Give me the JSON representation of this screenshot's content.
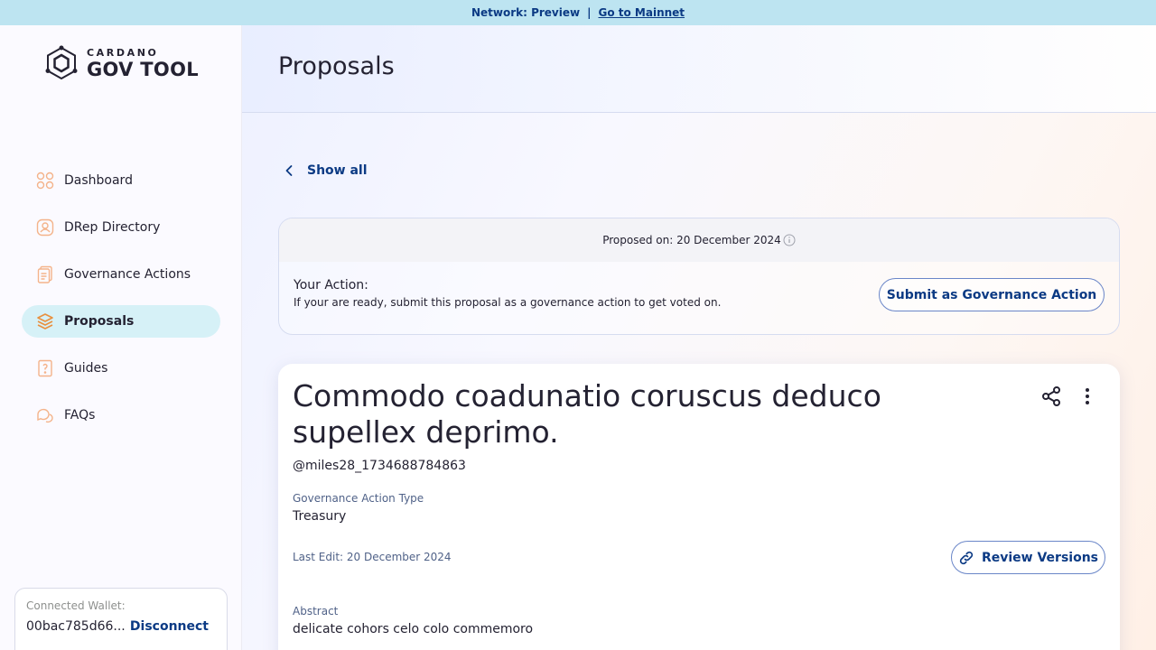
{
  "banner": {
    "network": "Network: Preview",
    "separator": "|",
    "link": "Go to Mainnet"
  },
  "logo": {
    "top": "CARDANO",
    "bottom": "GOV TOOL"
  },
  "nav": {
    "items": [
      {
        "label": "Dashboard",
        "icon": "dashboard-icon"
      },
      {
        "label": "DRep Directory",
        "icon": "drep-directory-icon"
      },
      {
        "label": "Governance Actions",
        "icon": "governance-actions-icon"
      },
      {
        "label": "Proposals",
        "icon": "proposals-icon",
        "active": true
      },
      {
        "label": "Guides",
        "icon": "guides-icon"
      },
      {
        "label": "FAQs",
        "icon": "faqs-icon"
      }
    ]
  },
  "wallet": {
    "label": "Connected Wallet:",
    "address": "00bac785d66...",
    "disconnect": "Disconnect"
  },
  "header": {
    "title": "Proposals"
  },
  "back": {
    "label": "Show all"
  },
  "action_card": {
    "proposed_on": "Proposed on: 20 December 2024",
    "title": "Your Action:",
    "subtitle": "If your are ready, submit this proposal as a governance action to get voted on.",
    "submit_label": "Submit as Governance Action"
  },
  "proposal": {
    "title": "Commodo coadunatio coruscus deduco supellex deprimo.",
    "author": "@miles28_1734688784863",
    "type_label": "Governance Action Type",
    "type_value": "Treasury",
    "last_edit": "Last Edit: 20 December 2024",
    "review_label": "Review Versions",
    "abstract_label": "Abstract",
    "abstract_value": "delicate cohors celo colo commemoro"
  },
  "colors": {
    "banner_bg": "#bde4f1",
    "primary": "#0b3a84",
    "active_nav": "#d6f1f7",
    "icon_accent": "#f4a261"
  }
}
